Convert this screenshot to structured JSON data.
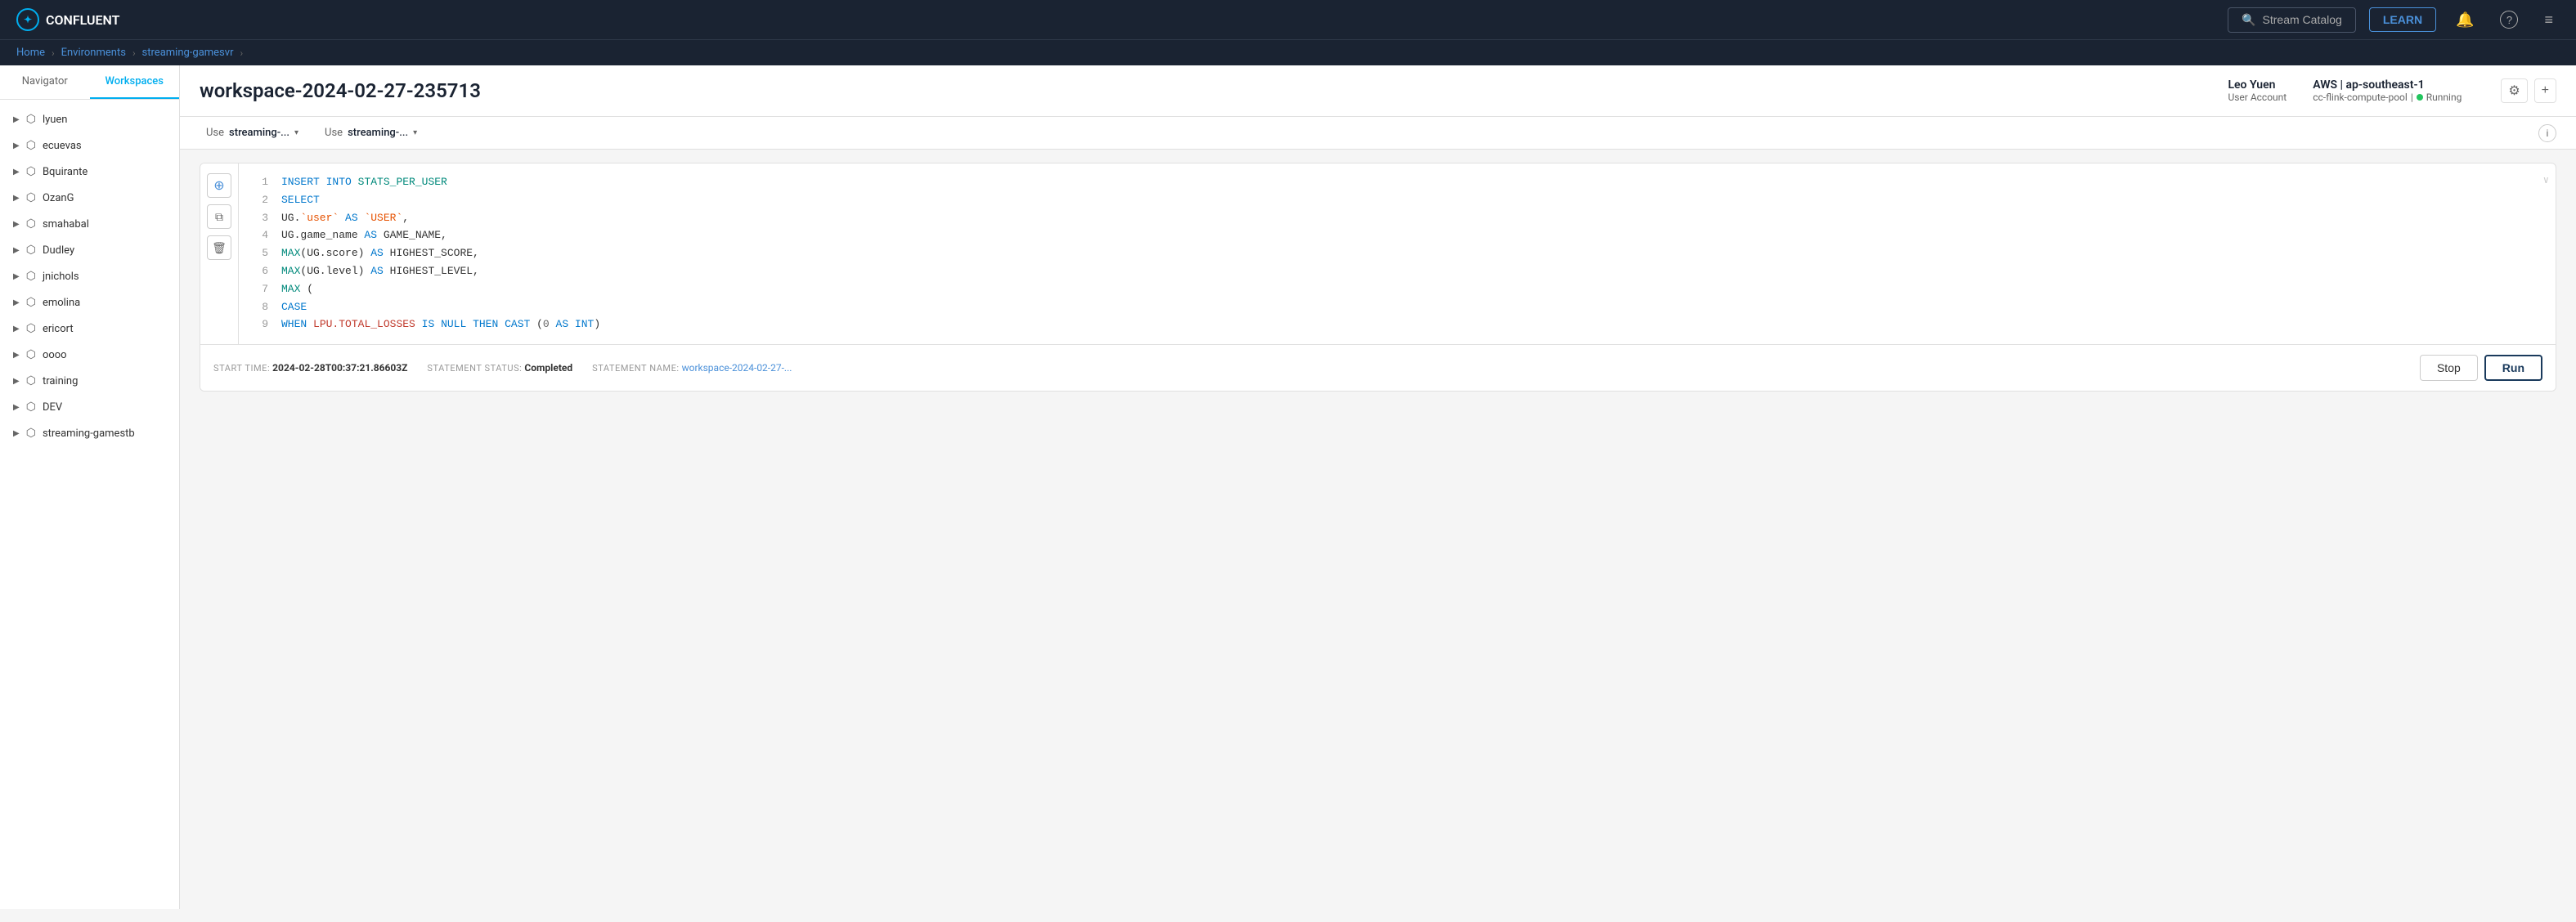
{
  "nav": {
    "logo_text": "CONFLUENT",
    "stream_catalog_placeholder": "Stream Catalog",
    "learn_label": "LEARN",
    "search_icon": "🔍",
    "bell_icon": "🔔",
    "help_icon": "?",
    "menu_icon": "≡"
  },
  "breadcrumb": {
    "home": "Home",
    "environments": "Environments",
    "current": "streaming-gamesvr"
  },
  "sidebar": {
    "tab_navigator": "Navigator",
    "tab_workspaces": "Workspaces",
    "items": [
      {
        "name": "lyuen"
      },
      {
        "name": "ecuevas"
      },
      {
        "name": "Bquirante"
      },
      {
        "name": "OzanG"
      },
      {
        "name": "smahabal"
      },
      {
        "name": "Dudley"
      },
      {
        "name": "jnichols"
      },
      {
        "name": "emolina"
      },
      {
        "name": "ericort"
      },
      {
        "name": "oooo"
      },
      {
        "name": "training"
      },
      {
        "name": "DEV"
      },
      {
        "name": "streaming-gamestb"
      }
    ]
  },
  "workspace": {
    "title": "workspace-2024-02-27-235713",
    "user_name": "Leo Yuen",
    "user_role": "User Account",
    "region": "AWS | ap-southeast-1",
    "compute_pool": "cc-flink-compute-pool",
    "status": "Running",
    "settings_icon": "⚙",
    "add_icon": "+"
  },
  "db_selectors": {
    "label1": "Use",
    "value1": "streaming-...",
    "label2": "Use",
    "value2": "streaming-...",
    "info_icon": "i"
  },
  "editor": {
    "add_icon": "+",
    "copy_icon": "⧉",
    "delete_icon": "🗑",
    "scroll_icon": "∨",
    "code_lines": [
      {
        "num": "1",
        "content": "INSERT INTO STATS_PER_USER",
        "type": "insert"
      },
      {
        "num": "2",
        "content": "SELECT",
        "type": "keyword"
      },
      {
        "num": "3",
        "content": "    UG.`user` AS `USER`,",
        "type": "field"
      },
      {
        "num": "4",
        "content": "    UG.game_name AS GAME_NAME,",
        "type": "field"
      },
      {
        "num": "5",
        "content": "    MAX(UG.score) AS HIGHEST_SCORE,",
        "type": "field"
      },
      {
        "num": "6",
        "content": "    MAX(UG.level) AS HIGHEST_LEVEL,",
        "type": "field"
      },
      {
        "num": "7",
        "content": "    MAX (",
        "type": "field"
      },
      {
        "num": "8",
        "content": "        CASE",
        "type": "keyword"
      },
      {
        "num": "9",
        "content": "            WHEN LPU.TOTAL_LOSSES IS NULL THEN CAST (0 AS INT)",
        "type": "condition"
      }
    ],
    "footer": {
      "start_time_label": "START TIME:",
      "start_time_value": "2024-02-28T00:37:21.86603Z",
      "status_label": "STATEMENT STATUS:",
      "status_value": "Completed",
      "name_label": "STATEMENT NAME:",
      "name_value": "workspace-2024-02-27-..."
    },
    "stop_label": "Stop",
    "run_label": "Run"
  }
}
